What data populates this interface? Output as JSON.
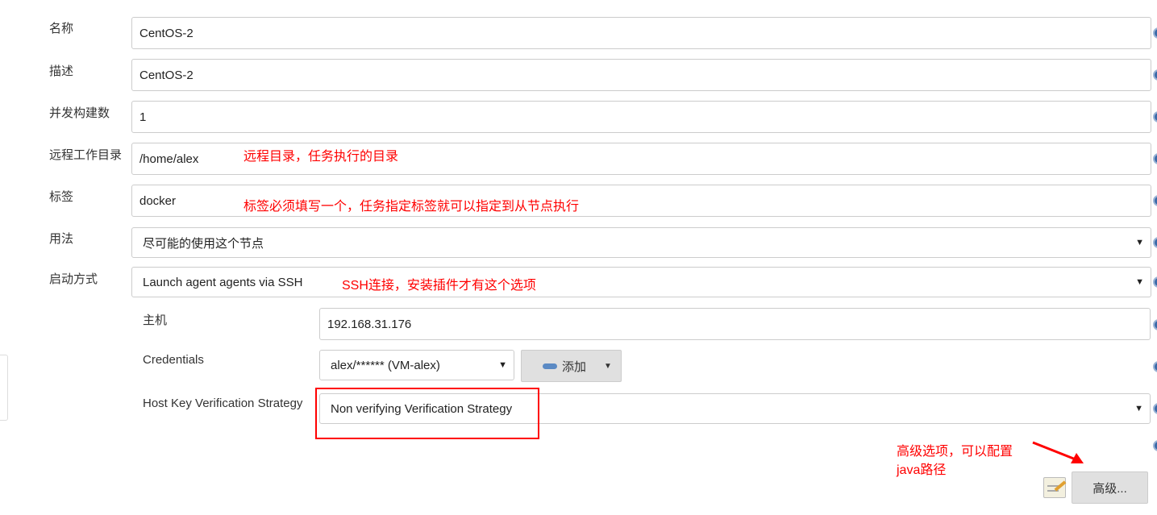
{
  "fields": [
    {
      "label": "名称",
      "value": "CentOS-2"
    },
    {
      "label": "描述",
      "value": "CentOS-2"
    },
    {
      "label": "并发构建数",
      "value": "1"
    },
    {
      "label": "远程工作目录",
      "value": "/home/alex"
    },
    {
      "label": "标签",
      "value": "docker"
    }
  ],
  "usage": {
    "label": "用法",
    "value": "尽可能的使用这个节点"
  },
  "launch": {
    "label": "启动方式",
    "value": "Launch agent agents via SSH"
  },
  "host": {
    "label": "主机",
    "value": "192.168.31.176"
  },
  "credentials": {
    "label": "Credentials",
    "value": "alex/****** (VM-alex)",
    "add_label": "添加"
  },
  "hostkey": {
    "label": "Host Key Verification Strategy",
    "value": "Non verifying Verification Strategy"
  },
  "advanced": {
    "label": "高级..."
  },
  "annotations": {
    "remote_dir": "远程目录，任务执行的目录",
    "labels": "标签必须填写一个，任务指定标签就可以指定到从节点执行",
    "ssh": "SSH连接，安装插件才有这个选项",
    "advanced_line1": "高级选项，可以配置",
    "advanced_line2": "java路径"
  },
  "colors": {
    "annotation": "#ff0000",
    "help": "#3c6aa8"
  }
}
